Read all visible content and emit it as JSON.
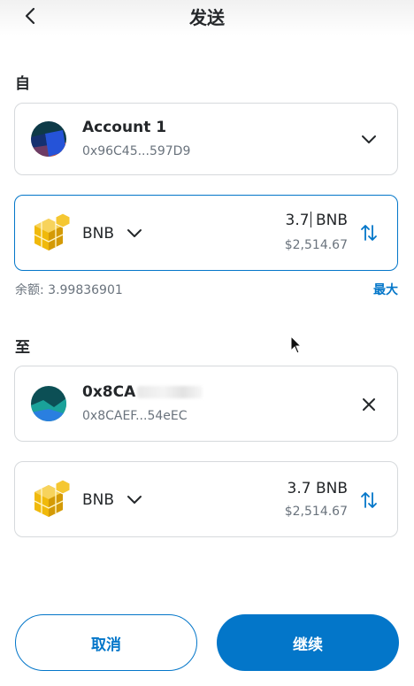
{
  "header": {
    "title": "发送"
  },
  "from": {
    "label": "自",
    "account_name": "Account 1",
    "account_address": "0x96C45...597D9"
  },
  "asset": {
    "symbol": "BNB",
    "amount": "3.7",
    "amount_unit": "BNB",
    "fiat": "$2,514.67"
  },
  "balance": {
    "text": "余额: 3.99836901",
    "max_label": "最大"
  },
  "to": {
    "label": "至",
    "name_visible": "0x8CA",
    "address": "0x8CAEF...54eEC"
  },
  "receive_asset": {
    "symbol": "BNB",
    "amount": "3.7 BNB",
    "fiat": "$2,514.67"
  },
  "actions": {
    "cancel_label": "取消",
    "continue_label": "继续"
  },
  "colors": {
    "accent": "#0376c9",
    "border": "#d6d9dc",
    "muted": "#6a737d",
    "text": "#24272a"
  }
}
